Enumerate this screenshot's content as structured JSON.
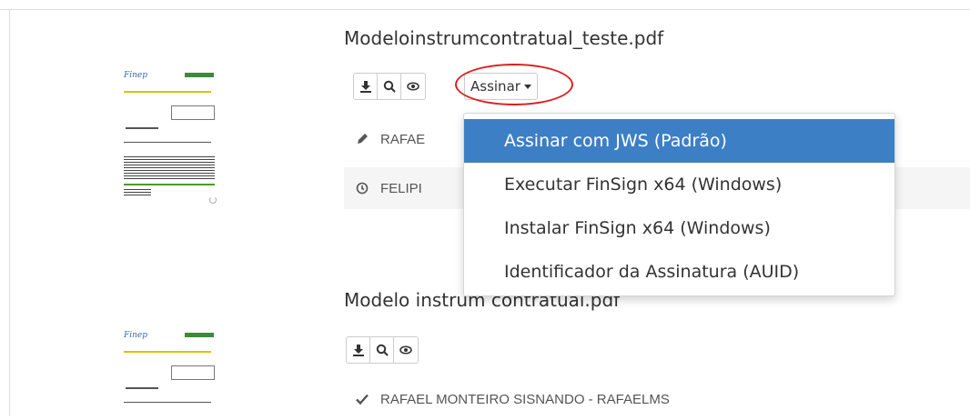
{
  "documents": [
    {
      "title": "Modeloinstrumcontratual_teste.pdf",
      "thumbnail_logo": "Finep",
      "actions": [
        {
          "name": "download-icon"
        },
        {
          "name": "search-icon"
        },
        {
          "name": "eye-icon"
        }
      ],
      "sign_button_label": "Assinar",
      "signers": [
        {
          "status_icon": "pencil-icon",
          "name": "RAFAE"
        },
        {
          "status_icon": "clock-icon",
          "name": "FELIPI"
        }
      ]
    },
    {
      "title": "Modelo instrum contratual.pdf",
      "thumbnail_logo": "Finep",
      "actions": [
        {
          "name": "download-icon"
        },
        {
          "name": "search-icon"
        },
        {
          "name": "eye-icon"
        }
      ],
      "signers": [
        {
          "status_icon": "check-icon",
          "name": "RAFAEL MONTEIRO SISNANDO - RAFAELMS"
        }
      ]
    }
  ],
  "sign_menu": {
    "items": [
      {
        "label": "Assinar com JWS (Padrão)",
        "active": true
      },
      {
        "label": "Executar FinSign x64 (Windows)",
        "active": false
      },
      {
        "label": "Instalar FinSign x64 (Windows)",
        "active": false
      },
      {
        "label": "Identificador da Assinatura (AUID)",
        "active": false
      }
    ]
  },
  "colors": {
    "highlight": "#3d7fc5",
    "annotation": "#d92020",
    "row_alt": "#f5f5f5"
  }
}
